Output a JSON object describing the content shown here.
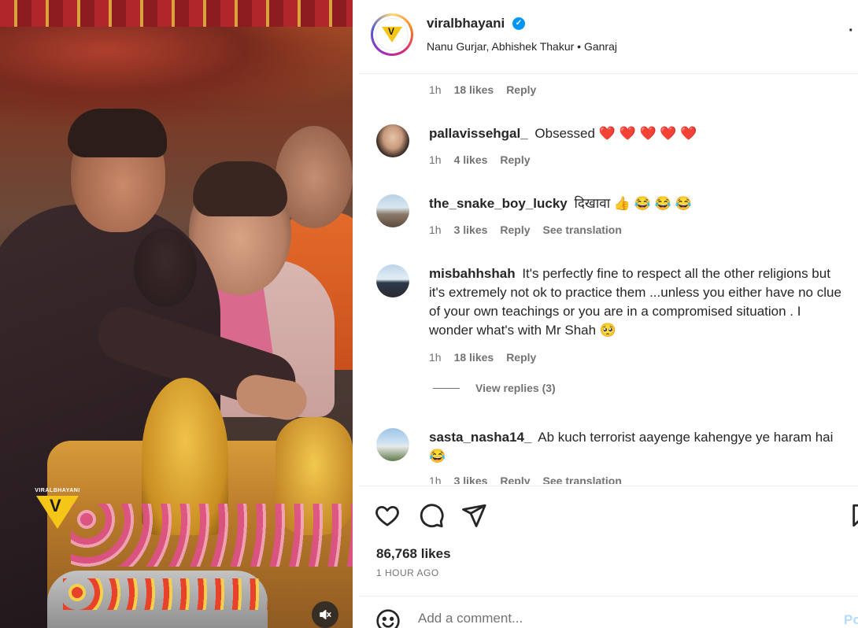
{
  "media": {
    "watermark": "VIRALBHAYANI",
    "mute_icon": "speaker-muted-icon"
  },
  "header": {
    "username": "viralbhayani",
    "subline": "Nanu Gurjar, Abhishek Thakur • Ganraj",
    "more_label": "·"
  },
  "comments": {
    "top_meta": {
      "time": "1h",
      "likes": "18 likes",
      "reply": "Reply"
    },
    "items": [
      {
        "user": "pallavissehgal_",
        "text": "Obsessed ❤️ ❤️ ❤️ ❤️ ❤️",
        "time": "1h",
        "likes": "4 likes",
        "reply": "Reply"
      },
      {
        "user": "the_snake_boy_lucky",
        "text": "दिखावा 👍 😂 😂 😂",
        "time": "1h",
        "likes": "3 likes",
        "reply": "Reply",
        "translate": "See translation"
      },
      {
        "user": "misbahhshah",
        "text": "It's perfectly fine to respect all the other religions but it's extremely not ok to practice them ...unless you either have no clue of your own teachings or you are in a compromised situation . I wonder what's with Mr Shah 🥺",
        "time": "1h",
        "likes": "18 likes",
        "reply": "Reply"
      },
      {
        "user": "sasta_nasha14_",
        "text": "Ab kuch terrorist aayenge kahengye ye haram hai😂",
        "time": "1h",
        "likes": "3 likes",
        "reply": "Reply",
        "translate": "See translation"
      }
    ],
    "view_replies": "View replies (3)"
  },
  "actions": {
    "like_icon": "heart-icon",
    "comment_icon": "comment-icon",
    "share_icon": "share-icon",
    "save_icon": "bookmark-icon",
    "likes_count": "86,768 likes",
    "time_ago": "1 HOUR AGO"
  },
  "add_comment": {
    "placeholder": "Add a comment...",
    "post_label": "Po"
  },
  "colors": {
    "verified": "#0095f6",
    "muted_text": "#737373",
    "brand_yellow": "#f5c518"
  }
}
